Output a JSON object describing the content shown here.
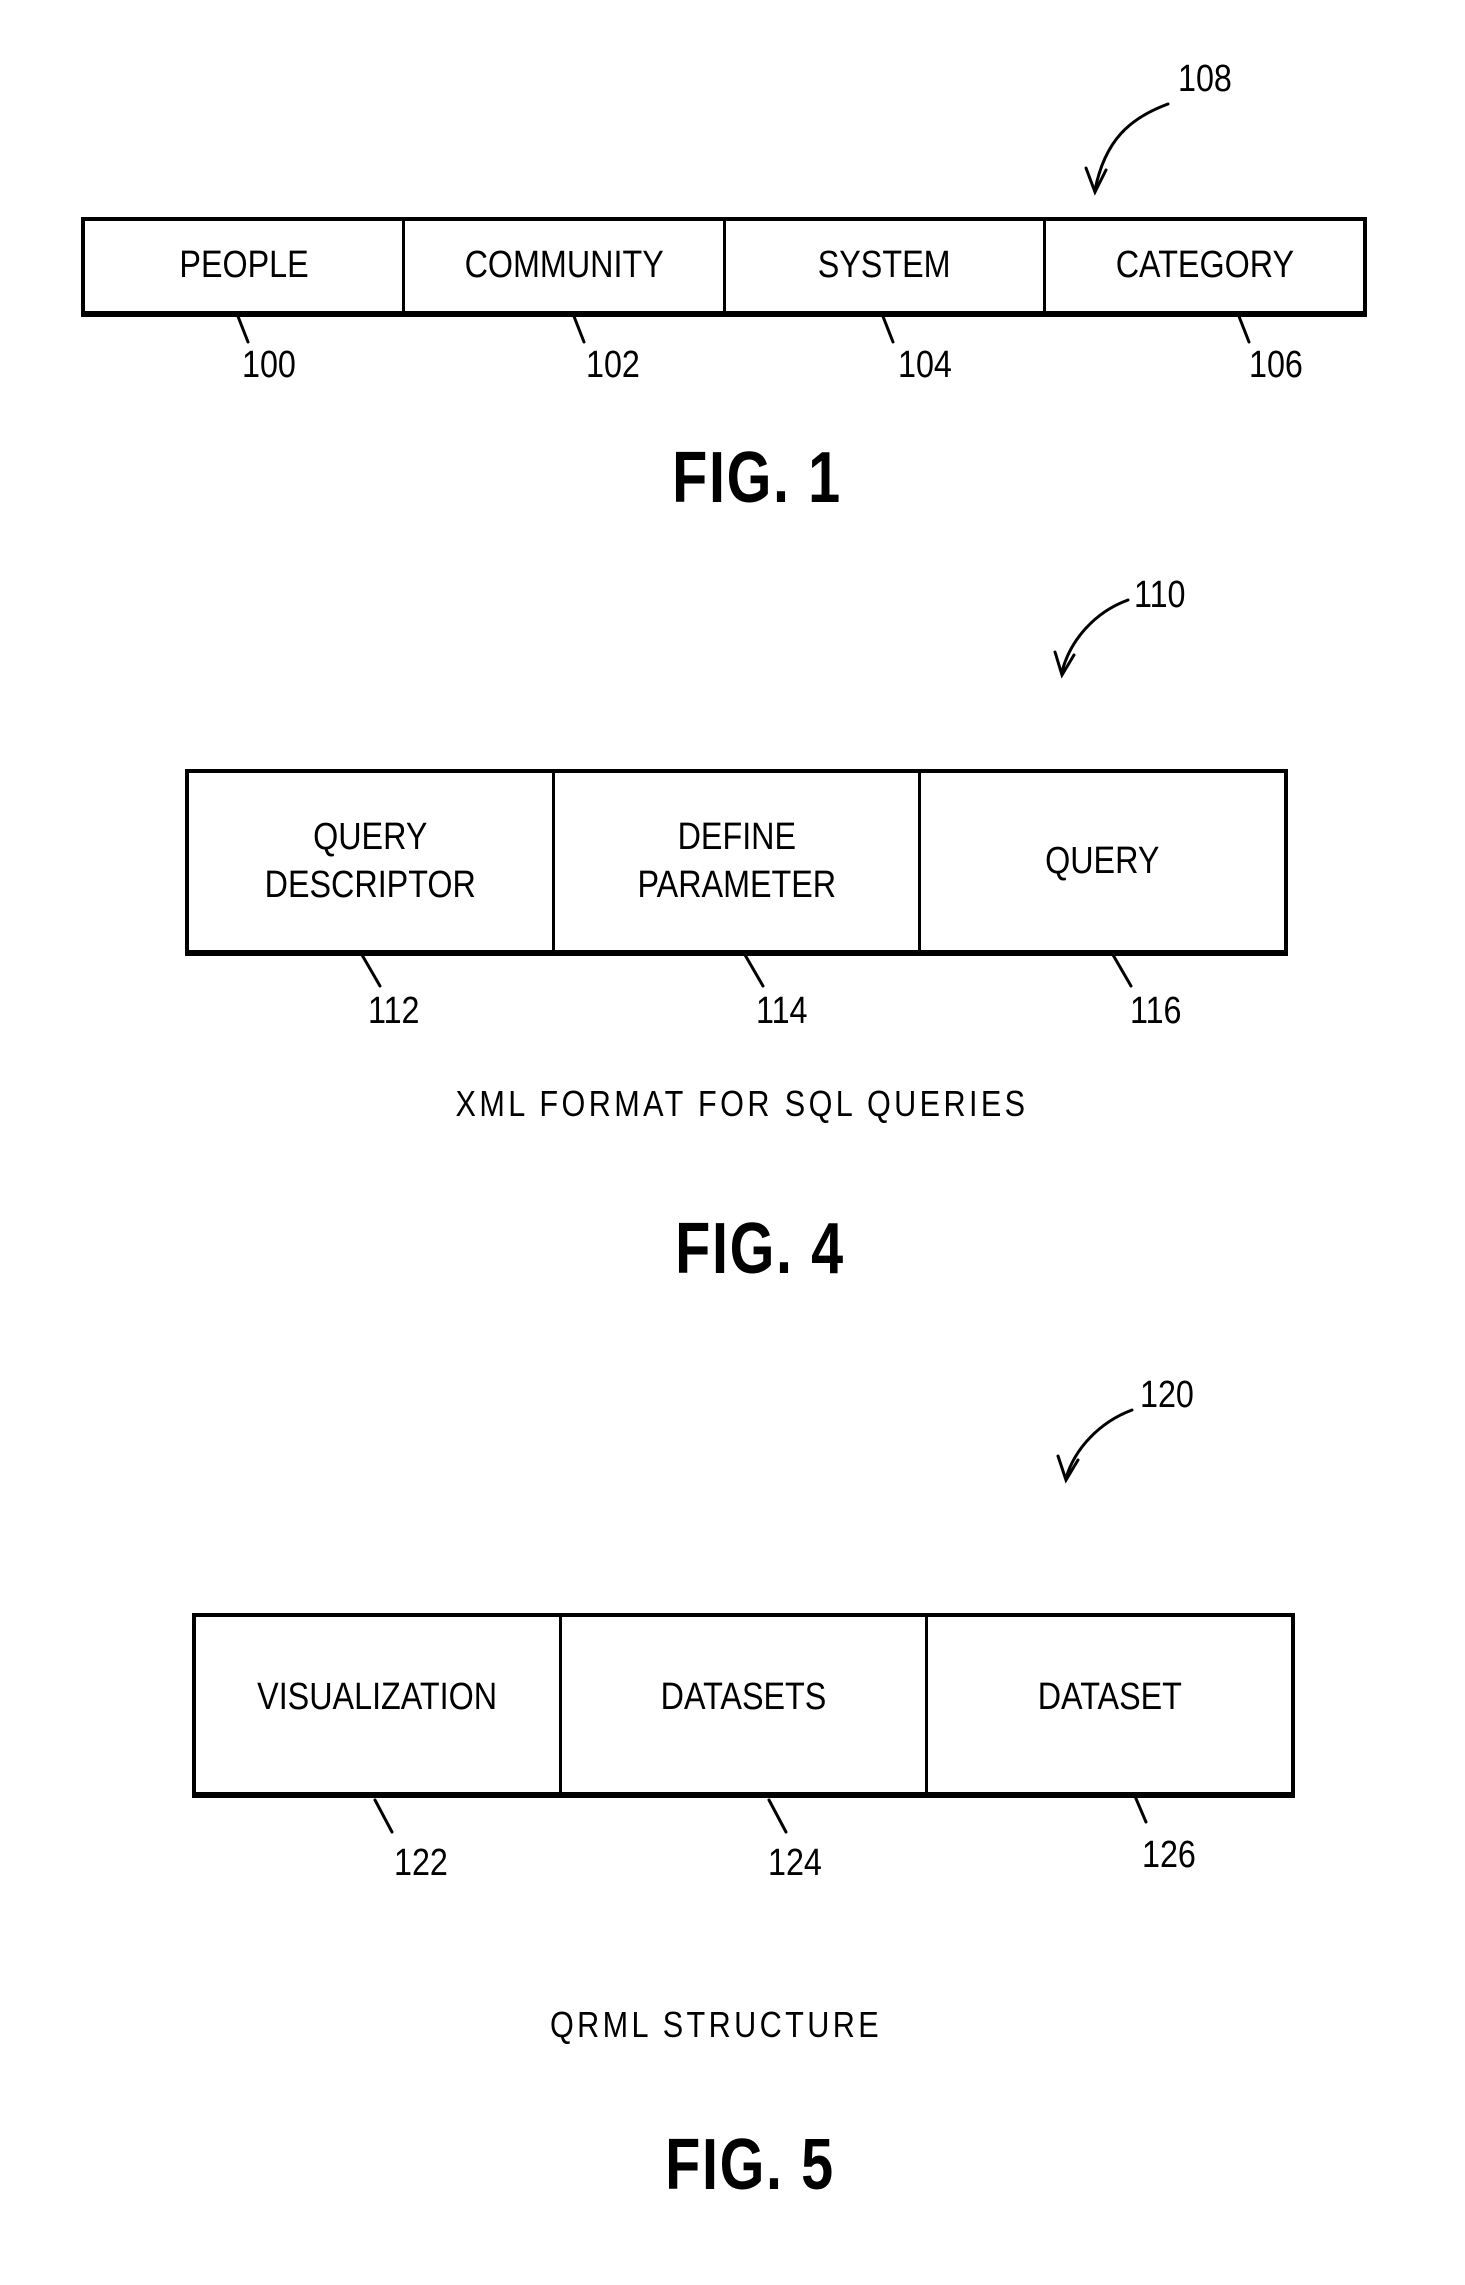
{
  "figures": [
    {
      "id": "fig1",
      "title": "FIG. 1",
      "reference": "108",
      "caption": "",
      "cells": [
        {
          "label": "PEOPLE",
          "ref": "100"
        },
        {
          "label": "COMMUNITY",
          "ref": "102"
        },
        {
          "label": "SYSTEM",
          "ref": "104"
        },
        {
          "label": "CATEGORY",
          "ref": "106"
        }
      ]
    },
    {
      "id": "fig4",
      "title": "FIG. 4",
      "reference": "110",
      "caption": "XML FORMAT FOR SQL QUERIES",
      "cells": [
        {
          "label": "QUERY\nDESCRIPTOR",
          "ref": "112"
        },
        {
          "label": "DEFINE\nPARAMETER",
          "ref": "114"
        },
        {
          "label": "QUERY",
          "ref": "116"
        }
      ]
    },
    {
      "id": "fig5",
      "title": "FIG. 5",
      "reference": "120",
      "caption": "QRML STRUCTURE",
      "cells": [
        {
          "label": "VISUALIZATION",
          "ref": "122"
        },
        {
          "label": "DATASETS",
          "ref": "124"
        },
        {
          "label": "DATASET",
          "ref": "126"
        }
      ]
    }
  ]
}
